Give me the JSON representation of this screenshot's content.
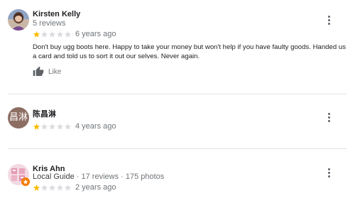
{
  "reviews": [
    {
      "name": "Kirsten Kelly",
      "meta": "5 reviews",
      "rating": 1,
      "max_rating": 5,
      "time": "6 years ago",
      "text": "Don't buy ugg boots here. Happy to take your money but won't  help if you have faulty goods. Handed us a card and told us to sort it out our selves. Never again.",
      "like_label": "Like"
    },
    {
      "name": "陈昌淋",
      "avatar_letter": "昌淋",
      "rating": 1,
      "max_rating": 5,
      "time": "4 years ago"
    },
    {
      "name": "Kris Ahn",
      "meta_guide": "Local Guide",
      "meta": " · 17 reviews · 175 photos",
      "rating": 1,
      "max_rating": 5,
      "time": "2 years ago"
    }
  ],
  "colors": {
    "star_filled": "#fbbc04",
    "star_empty": "#dadce0",
    "avatar_brown": "#8d6e63",
    "local_guide_badge": "#f57c00"
  },
  "icons": {
    "more": "more-vert-icon",
    "like": "thumb-up-icon",
    "star": "star-icon"
  }
}
